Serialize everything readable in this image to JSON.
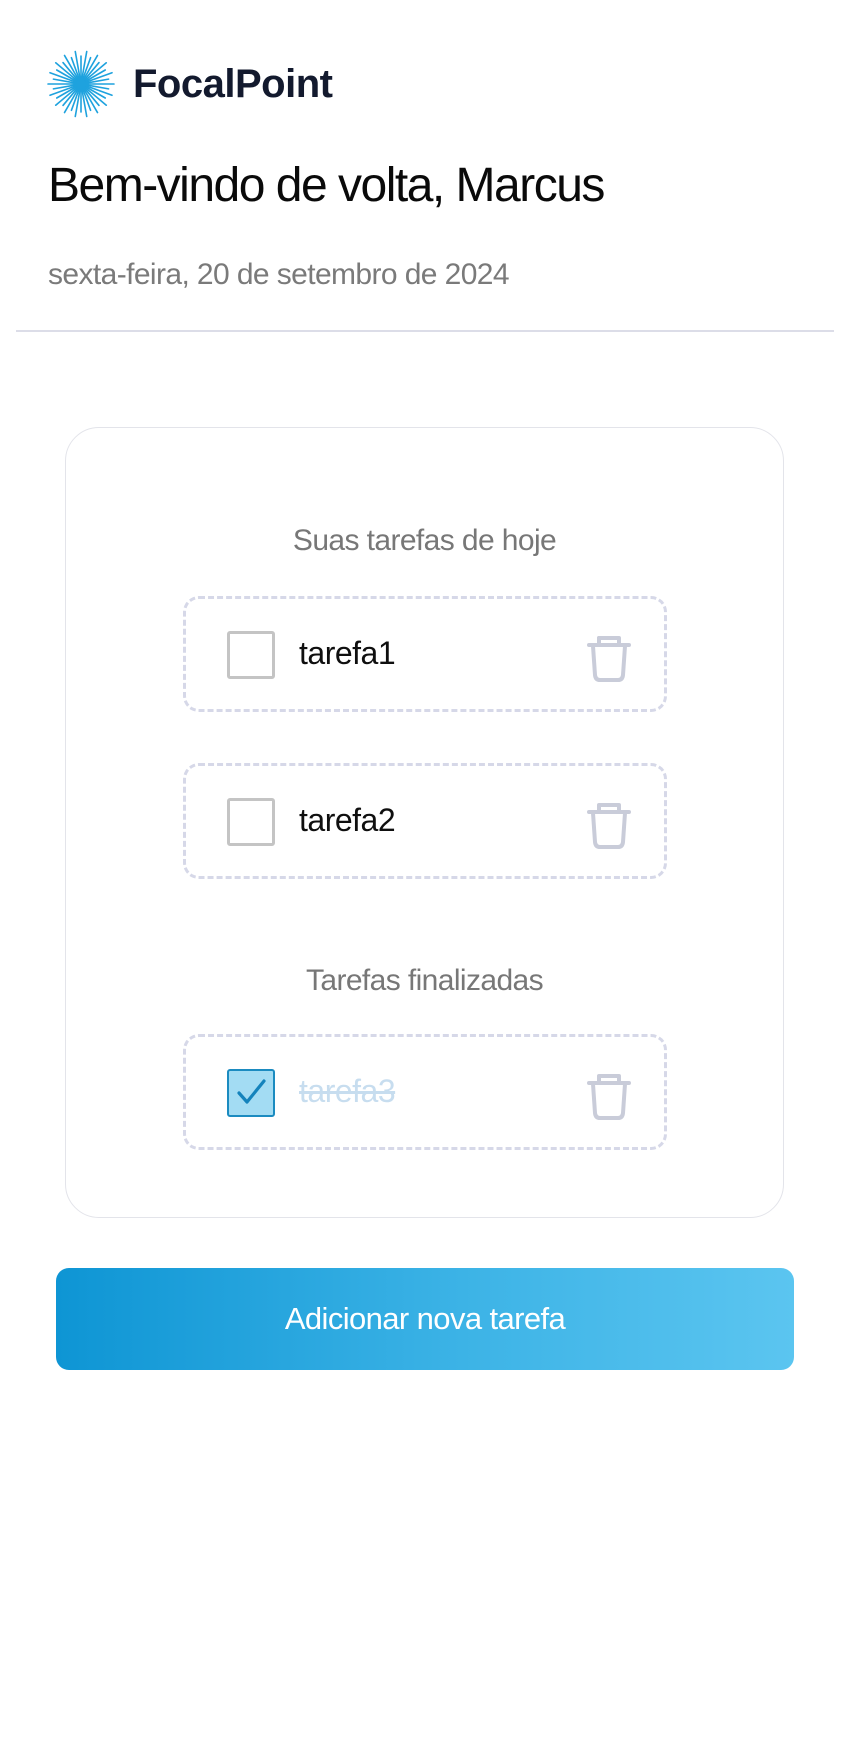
{
  "brand": {
    "name": "FocalPoint",
    "logo_icon": "starburst-icon",
    "color": "#1ea2de"
  },
  "header": {
    "welcome": "Bem-vindo de volta, Marcus",
    "date": "sexta-feira, 20 de setembro de 2024"
  },
  "today": {
    "title": "Suas tarefas de hoje",
    "tasks": [
      {
        "label": "tarefa1",
        "checked": false
      },
      {
        "label": "tarefa2",
        "checked": false
      }
    ]
  },
  "finished": {
    "title": "Tarefas finalizadas",
    "tasks": [
      {
        "label": "tarefa3",
        "checked": true
      }
    ]
  },
  "icons": {
    "delete": "trash-icon",
    "check": "checkmark-icon"
  },
  "add_button": {
    "label": "Adicionar nova tarefa"
  },
  "colors": {
    "accent": "#1b9ad8",
    "accent_light": "#5bc5f0",
    "checked_fill": "#a3dcf3"
  }
}
